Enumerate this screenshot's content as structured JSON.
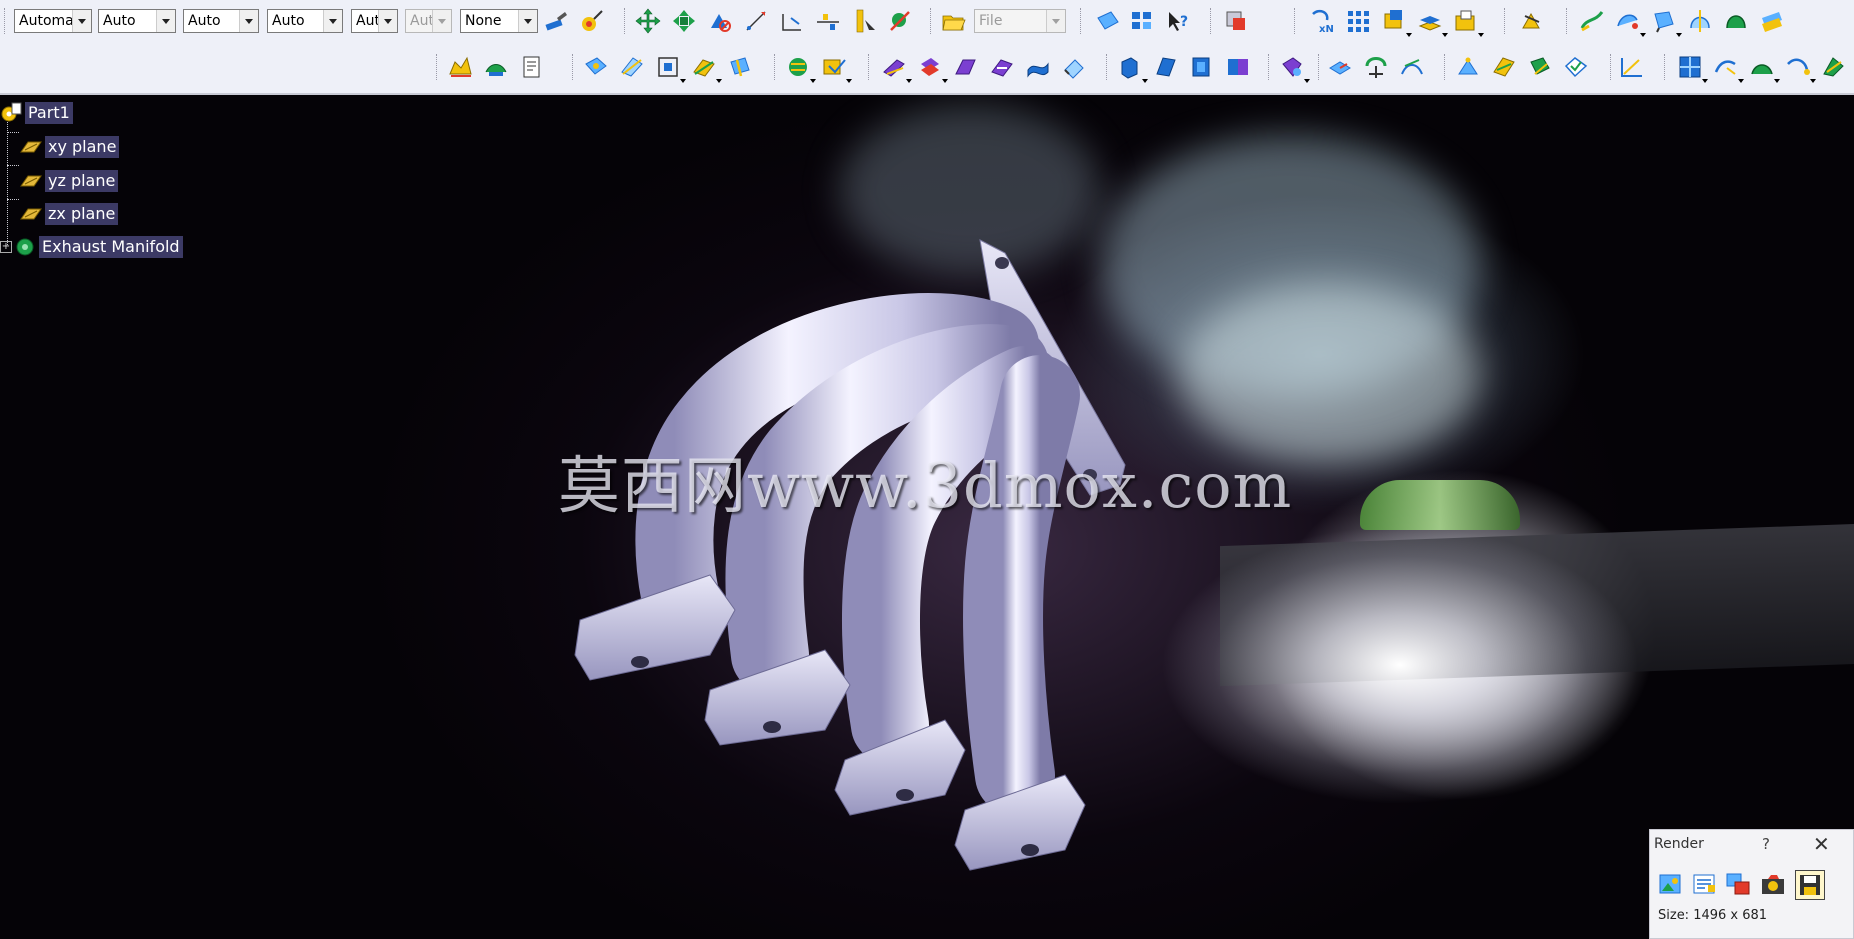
{
  "toolbar": {
    "combos": [
      {
        "id": "linetype",
        "value": "Automa",
        "disabled": false
      },
      {
        "id": "color",
        "value": "Auto",
        "disabled": false
      },
      {
        "id": "thickness",
        "value": "Auto",
        "disabled": false
      },
      {
        "id": "linestyle",
        "value": "Auto",
        "disabled": false
      },
      {
        "id": "transparency",
        "value": "Aut",
        "disabled": false
      },
      {
        "id": "layer-opacity",
        "value": "Aut",
        "disabled": true
      },
      {
        "id": "layer",
        "value": "None",
        "disabled": false
      }
    ],
    "file_combo": {
      "value": "File",
      "disabled": true
    }
  },
  "tree": {
    "root": "Part1",
    "planes": [
      "xy plane",
      "yz plane",
      "zx plane"
    ],
    "body": "Exhaust Manifold"
  },
  "viewport": {
    "watermark": "莫西网www.3dmox.com",
    "part_color": "#c9c7e6"
  },
  "render_dialog": {
    "title": "Render",
    "help": "?",
    "close": "✕",
    "size_text": "Size: 1496 x 681"
  },
  "colors": {
    "toolbar_bg": "#eef0f8",
    "tree_label_bg": "#3c3a65",
    "icon_blue": "#1f6fd1",
    "icon_yellow": "#f2c20d",
    "icon_green": "#1da04a"
  }
}
